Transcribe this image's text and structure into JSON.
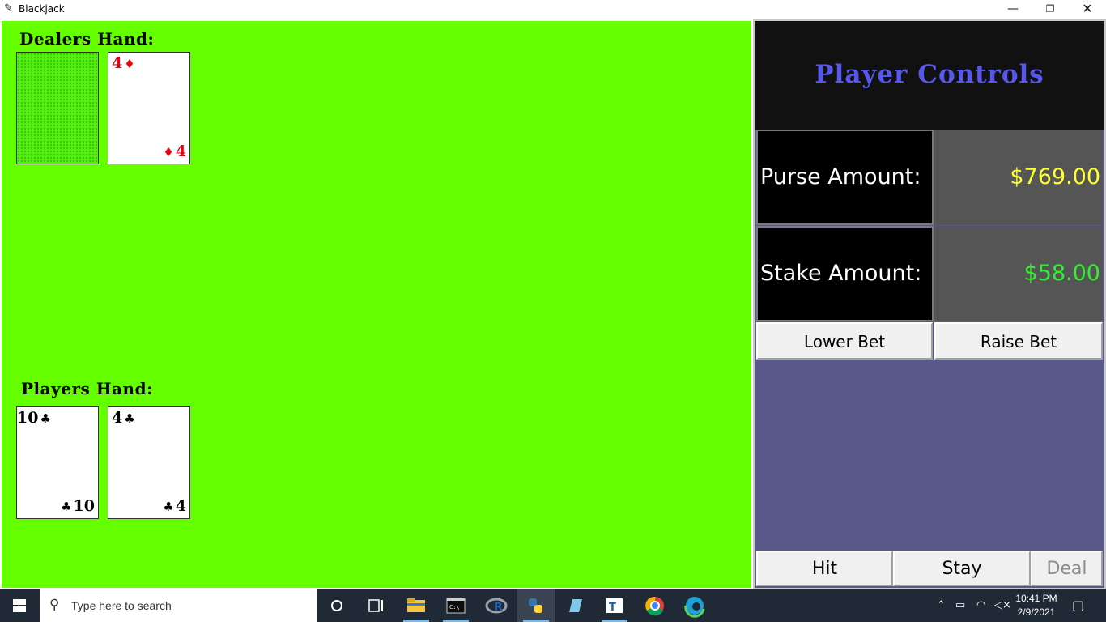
{
  "window": {
    "title": "Blackjack",
    "minimize": "—",
    "maximize": "❐",
    "close": "✕"
  },
  "table": {
    "background": "#66ff00",
    "dealer_label": "Dealers Hand:",
    "player_label": "Players Hand:",
    "dealer_cards": [
      {
        "face_down": true
      },
      {
        "rank": "4",
        "suit": "♦",
        "color": "#e8000b"
      }
    ],
    "player_cards": [
      {
        "rank": "10",
        "suit": "♣",
        "color": "#000000"
      },
      {
        "rank": "4",
        "suit": "♣",
        "color": "#000000"
      }
    ]
  },
  "panel": {
    "title": "Player Controls",
    "purse_label": "Purse Amount:",
    "purse_value": "$769.00",
    "purse_color": "#ffff33",
    "stake_label": "Stake Amount:",
    "stake_value": "$58.00",
    "stake_color": "#33ee33",
    "lower_bet": "Lower Bet",
    "raise_bet": "Raise Bet",
    "hit": "Hit",
    "stay": "Stay",
    "deal": "Deal"
  },
  "taskbar": {
    "search_placeholder": "Type here to search",
    "time": "10:41 PM",
    "date": "2/9/2021",
    "icons": [
      "windows-start-icon",
      "cortana-icon",
      "task-view-icon",
      "file-explorer-icon",
      "terminal-icon",
      "r-icon",
      "python-icon",
      "notepad-icon",
      "typora-icon",
      "chrome-icon",
      "edge-icon"
    ]
  }
}
